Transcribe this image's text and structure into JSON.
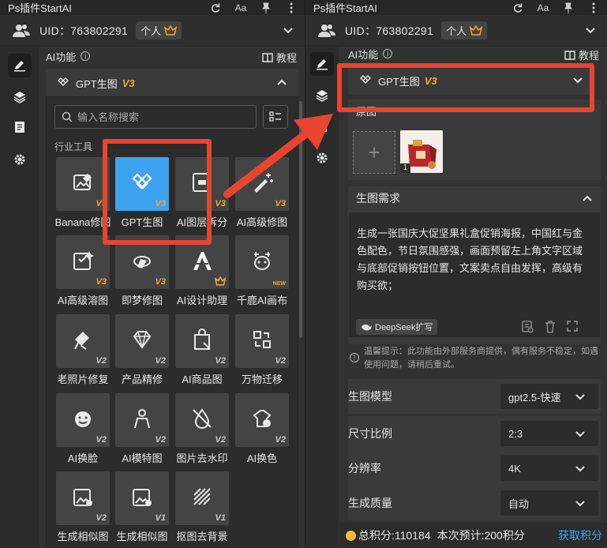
{
  "app": {
    "title": "Ps插件StartAI"
  },
  "user": {
    "uid_label": "UID：763802291",
    "plan": "个人"
  },
  "section": {
    "label": "AI功能",
    "tutorial": "教程"
  },
  "selected_tool": {
    "name": "GPT生图",
    "version": "V3"
  },
  "search": {
    "placeholder": "输入名称搜索"
  },
  "category": "行业工具",
  "tools": [
    {
      "label": "Banana修图",
      "version": "V3",
      "icon": "image-edit-icon"
    },
    {
      "label": "GPT生图",
      "version": "V3",
      "icon": "gpt-knot-icon"
    },
    {
      "label": "AI图层拆分",
      "version": "V3",
      "icon": "layer-split-icon"
    },
    {
      "label": "AI高级修图",
      "version": "V3",
      "icon": "magic-wand-icon"
    },
    {
      "label": "AI高级溶图",
      "version": "V3",
      "icon": "image-sparkle-icon"
    },
    {
      "label": "即梦修图",
      "version": "V3",
      "icon": "dream-icon"
    },
    {
      "label": "AI设计助理",
      "version": "",
      "icon": "design-assistant-icon"
    },
    {
      "label": "千鹿AI画布",
      "version": "NEW",
      "icon": "deer-canvas-icon"
    },
    {
      "label": "老照片修复",
      "version": "V2",
      "icon": "photo-repair-icon"
    },
    {
      "label": "产品精修",
      "version": "V2",
      "icon": "diamond-icon"
    },
    {
      "label": "AI商品图",
      "version": "V2",
      "icon": "product-image-icon"
    },
    {
      "label": "万物迁移",
      "version": "V2",
      "icon": "migrate-icon"
    },
    {
      "label": "AI换脸",
      "version": "V2",
      "icon": "face-swap-icon"
    },
    {
      "label": "AI模特图",
      "version": "V2",
      "icon": "model-icon"
    },
    {
      "label": "图片去水印",
      "version": "V2",
      "icon": "watermark-remove-icon"
    },
    {
      "label": "AI换色",
      "version": "V2",
      "icon": "recolor-icon"
    },
    {
      "label": "生成相似图",
      "version": "V2",
      "icon": "similar-image-icon"
    },
    {
      "label": "生成相似图",
      "version": "V1",
      "icon": "similar-image-icon"
    },
    {
      "label": "抠图去背景",
      "version": "V1",
      "icon": "cutout-icon"
    }
  ],
  "reference": {
    "label": "原图",
    "count": "1"
  },
  "prompt": {
    "header": "生图需求",
    "text": "生成一张国庆大促坚果礼盒促销海报，中国红与金色配色，节日氛围感强，画面预留左上角文字区域与底部促销按钮位置，文案卖点自由发挥，高级有购买欲；",
    "deepseek": "DeepSeek扩写"
  },
  "tip": "温馨提示：此功能由外部服务商提供，偶有服务不稳定，如遇使用问题，请稍后重试。",
  "settings": [
    {
      "label": "生图模型",
      "value": "gpt2.5-快速"
    },
    {
      "label": "尺寸比例",
      "value": "2:3"
    },
    {
      "label": "分辨率",
      "value": "4K"
    },
    {
      "label": "生成质量",
      "value": "自动"
    }
  ],
  "footer": {
    "total": "总积分:110184",
    "estimate": "本次预计:200积分",
    "get": "获取积分"
  },
  "colors": {
    "accent_blue": "#3da3f0",
    "version_gold": "#f0a830",
    "highlight_red": "#e8442f"
  }
}
